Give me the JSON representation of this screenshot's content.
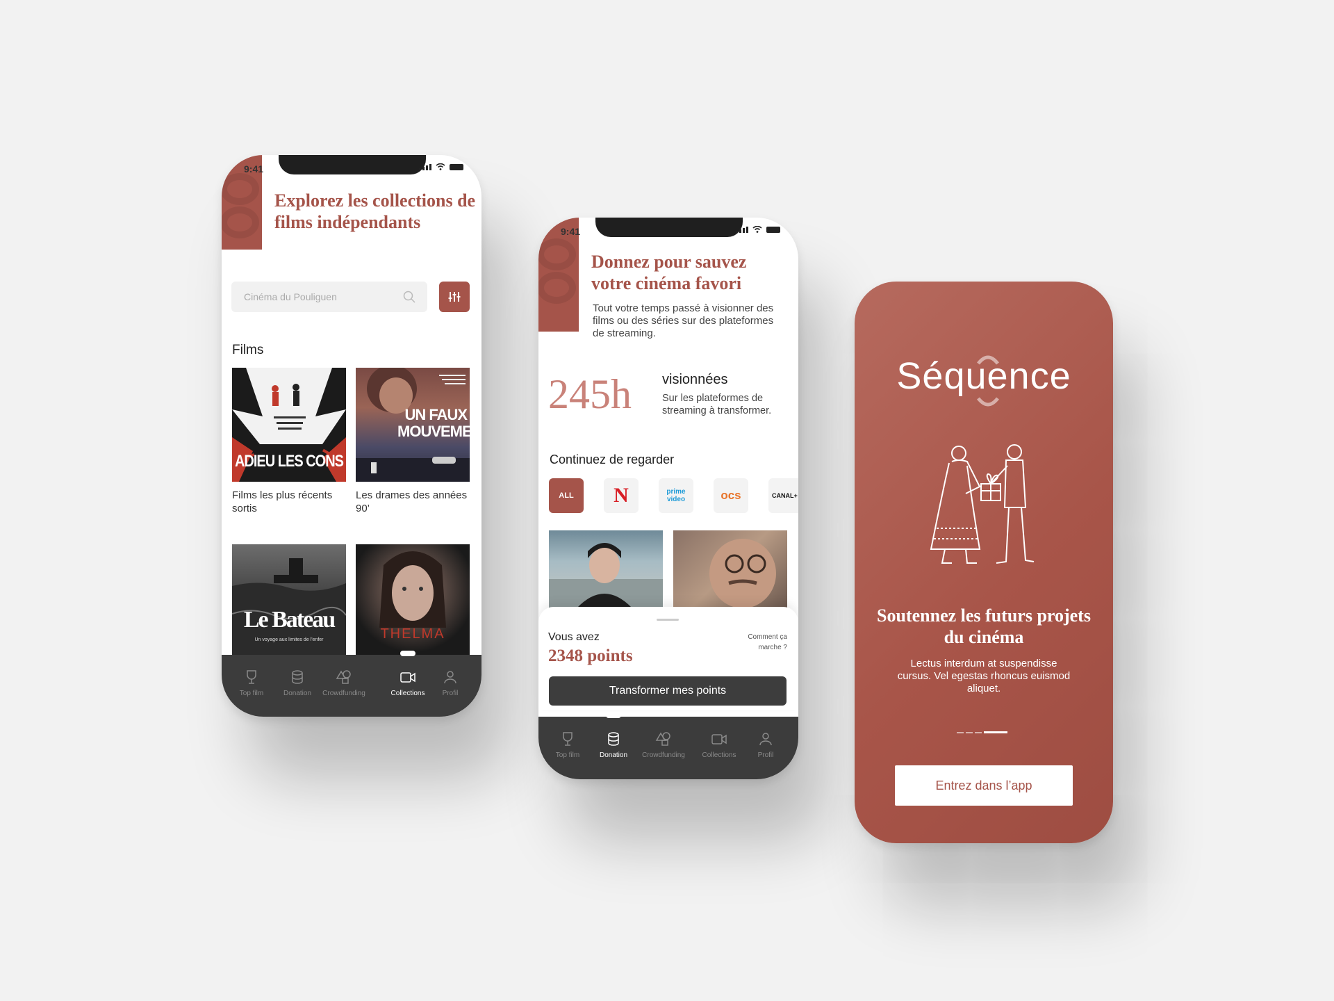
{
  "status_bar": {
    "time": "9:41"
  },
  "tabs": {
    "top_film": "Top film",
    "donation": "Donation",
    "crowdfunding": "Crowdfunding",
    "collections": "Collections",
    "profil": "Profil"
  },
  "collections_screen": {
    "title": "Explorez les collections de films indépendants",
    "search_placeholder": "Cinéma du Pouliguen",
    "section_films": "Films",
    "posters": [
      {
        "title": "ADIEU LES CONS",
        "caption": "Films les plus récents sortis"
      },
      {
        "title": "UN FAUX MOUVEMENT",
        "caption": "Les drames des années 90’"
      },
      {
        "title": "Le Bateau",
        "subtitle": "Un voyage aux limites de l'enfer"
      },
      {
        "title": "THELMA"
      }
    ],
    "active_tab": "Collections"
  },
  "donation_screen": {
    "title": "Donnez pour sauvez votre cinéma favori",
    "description": "Tout votre temps passé à visionner des films ou des séries sur des plateformes de streaming.",
    "hours_value": "245h",
    "viewed_label": "visionnées",
    "viewed_sub": "Sur les plateformes de streaming à transformer.",
    "continue_label": "Continuez de regarder",
    "platforms": [
      "ALL",
      "N",
      "prime video",
      "ocs",
      "CANAL+"
    ],
    "you_have": "Vous avez",
    "points": "2348 points",
    "how_it_works": "Comment ça marche ?",
    "transform_button": "Transformer mes points",
    "active_tab": "Donation"
  },
  "onboarding_screen": {
    "logo": "Séquence",
    "heading": "Soutennez les futurs projets du cinéma",
    "body": "Lectus interdum at suspendisse cursus. Vel egestas rhoncus euismod aliquet.",
    "enter_button": "Entrez dans l’app",
    "progress": {
      "current": 4,
      "total": 4
    }
  },
  "colors": {
    "accent": "#a5544a",
    "tabbar": "#3c3c3c",
    "background": "#f2f2f2"
  }
}
